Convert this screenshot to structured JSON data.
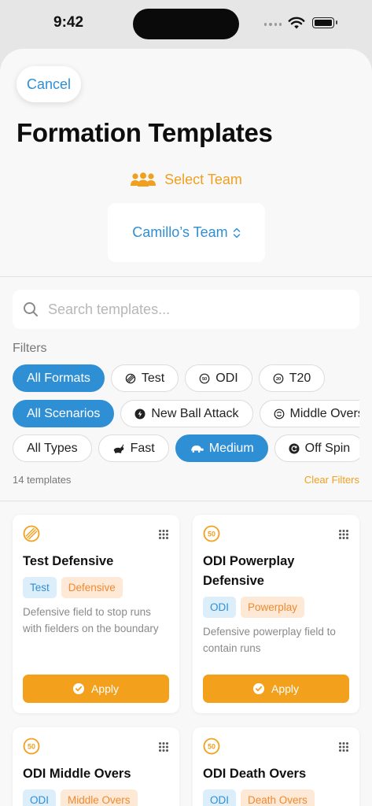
{
  "status": {
    "time": "9:42"
  },
  "header": {
    "cancel_label": "Cancel",
    "title": "Formation Templates"
  },
  "team": {
    "select_label": "Select Team",
    "current": "Camillo’s Team"
  },
  "search": {
    "placeholder": "Search templates...",
    "value": ""
  },
  "filters": {
    "label": "Filters",
    "formats": [
      "All Formats",
      "Test",
      "ODI",
      "T20"
    ],
    "scenarios": [
      "All Scenarios",
      "New Ball Attack",
      "Middle Overs"
    ],
    "types": [
      "All Types",
      "Fast",
      "Medium",
      "Off Spin"
    ],
    "count_text": "14 templates",
    "clear_label": "Clear Filters"
  },
  "cards": [
    {
      "title": "Test Defensive",
      "format_tag": "Test",
      "scenario_tag": "Defensive",
      "description": "Defensive field to stop runs with fielders on the boundary",
      "apply_label": "Apply"
    },
    {
      "title": "ODI Powerplay Defensive",
      "format_tag": "ODI",
      "scenario_tag": "Powerplay",
      "description": "Defensive powerplay field to contain runs",
      "apply_label": "Apply"
    },
    {
      "title": "ODI Middle Overs",
      "format_tag": "ODI",
      "scenario_tag": "Middle Overs"
    },
    {
      "title": "ODI Death Overs",
      "format_tag": "ODI",
      "scenario_tag": "Death Overs"
    }
  ],
  "icons": {
    "fifty_badge": "50",
    "twenty_badge": "20"
  },
  "colors": {
    "accent_blue": "#2f8fd4",
    "accent_orange": "#f0a01e",
    "apply_orange": "#f3a01c"
  }
}
